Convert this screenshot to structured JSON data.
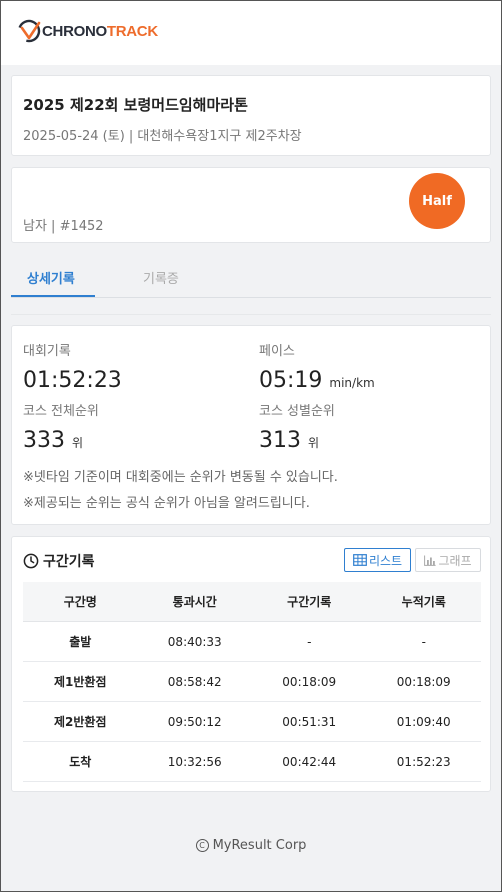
{
  "brand": {
    "name_part1": "CHRONO",
    "name_part2": "TRACK",
    "accent": "#ee6c2c",
    "dark": "#2a2f3a"
  },
  "event": {
    "title": "2025 제22회 보령머드임해마라톤",
    "subtitle": "2025-05-24 (토) | 대천해수욕장1지구 제2주차장"
  },
  "runner": {
    "info": "남자 | #1452",
    "course_badge": "Half",
    "badge_color": "#f06a24"
  },
  "tabs": [
    {
      "label": "상세기록",
      "active": true
    },
    {
      "label": "기록증",
      "active": false
    }
  ],
  "record": {
    "finish_label": "대회기록",
    "finish_value": "01:52:23",
    "pace_label": "페이스",
    "pace_value": "05:19",
    "pace_unit": "min/km",
    "overall_rank_label": "코스 전체순위",
    "overall_rank_value": "333",
    "gender_rank_label": "코스 성별순위",
    "gender_rank_value": "313",
    "rank_unit": "위",
    "note1": "※넷타임 기준이며 대회중에는 순위가 변동될 수 있습니다.",
    "note2": "※제공되는 순위는 공식 순위가 아님을 알려드립니다."
  },
  "splits": {
    "title": "구간기록",
    "list_button": "리스트",
    "graph_button": "그래프",
    "headers": [
      "구간명",
      "통과시간",
      "구간기록",
      "누적기록"
    ],
    "rows": [
      [
        "출발",
        "08:40:33",
        "-",
        "-"
      ],
      [
        "제1반환점",
        "08:58:42",
        "00:18:09",
        "00:18:09"
      ],
      [
        "제2반환점",
        "09:50:12",
        "00:51:31",
        "01:09:40"
      ],
      [
        "도착",
        "10:32:56",
        "00:42:44",
        "01:52:23"
      ]
    ]
  },
  "footer": {
    "text": "MyResult Corp"
  },
  "icons": {
    "clock": "clock-icon",
    "table": "table-icon",
    "bar_chart": "bar-chart-icon",
    "copyright": "copyright-icon"
  },
  "colors": {
    "primary": "#2f7fd0",
    "badge": "#f06a24"
  }
}
